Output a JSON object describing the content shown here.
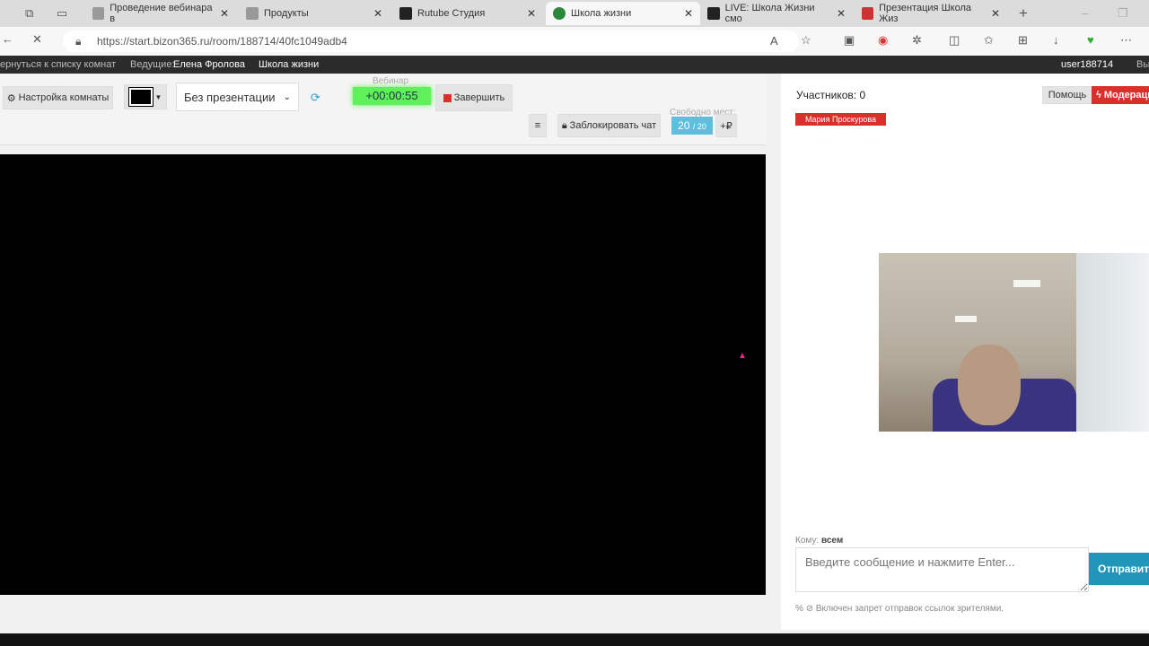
{
  "browser": {
    "tabs": [
      {
        "title": "Проведение вебинара в",
        "active": false
      },
      {
        "title": "Продукты",
        "active": false
      },
      {
        "title": "Rutube Студия",
        "active": false
      },
      {
        "title": "Школа жизни",
        "active": true
      },
      {
        "title": "LIVE: Школа Жизни смо",
        "active": false
      },
      {
        "title": "Презентация Школа Жиз",
        "active": false
      }
    ],
    "url": "https://start.bizon365.ru/room/188714/40fc1049adb4"
  },
  "topnav": {
    "back": "ернуться к списку комнат",
    "host_label": "Ведущие:",
    "host_name": "Елена Фролова",
    "room": "Школа жизни",
    "user": "user188714",
    "exit": "Вы"
  },
  "toolbar": {
    "settings": "Настройка комнаты",
    "presentation": "Без презентации",
    "webinar_label": "Вебинар",
    "timer": "+00:00:55",
    "finish": "Завершить",
    "menu": "≡",
    "block_chat": "Заблокировать чат",
    "free_label": "Свободно мест:",
    "free": "20",
    "total": "/ 20",
    "add": "+₽"
  },
  "right": {
    "participants": "Участников: 0",
    "help": "Помощь",
    "moderation": "Модерация",
    "user_badge": "Мария Проскурова",
    "to_label": "Кому:",
    "to_value": "всем",
    "placeholder": "Введите сообщение и нажмите Enter...",
    "send": "Отправить",
    "note": "Включен запрет отправок ссылок зрителями."
  },
  "colors": {
    "timer": "#5ff05a",
    "red": "#d9302c",
    "blue": "#2196b8",
    "seats": "#5bc0de"
  }
}
